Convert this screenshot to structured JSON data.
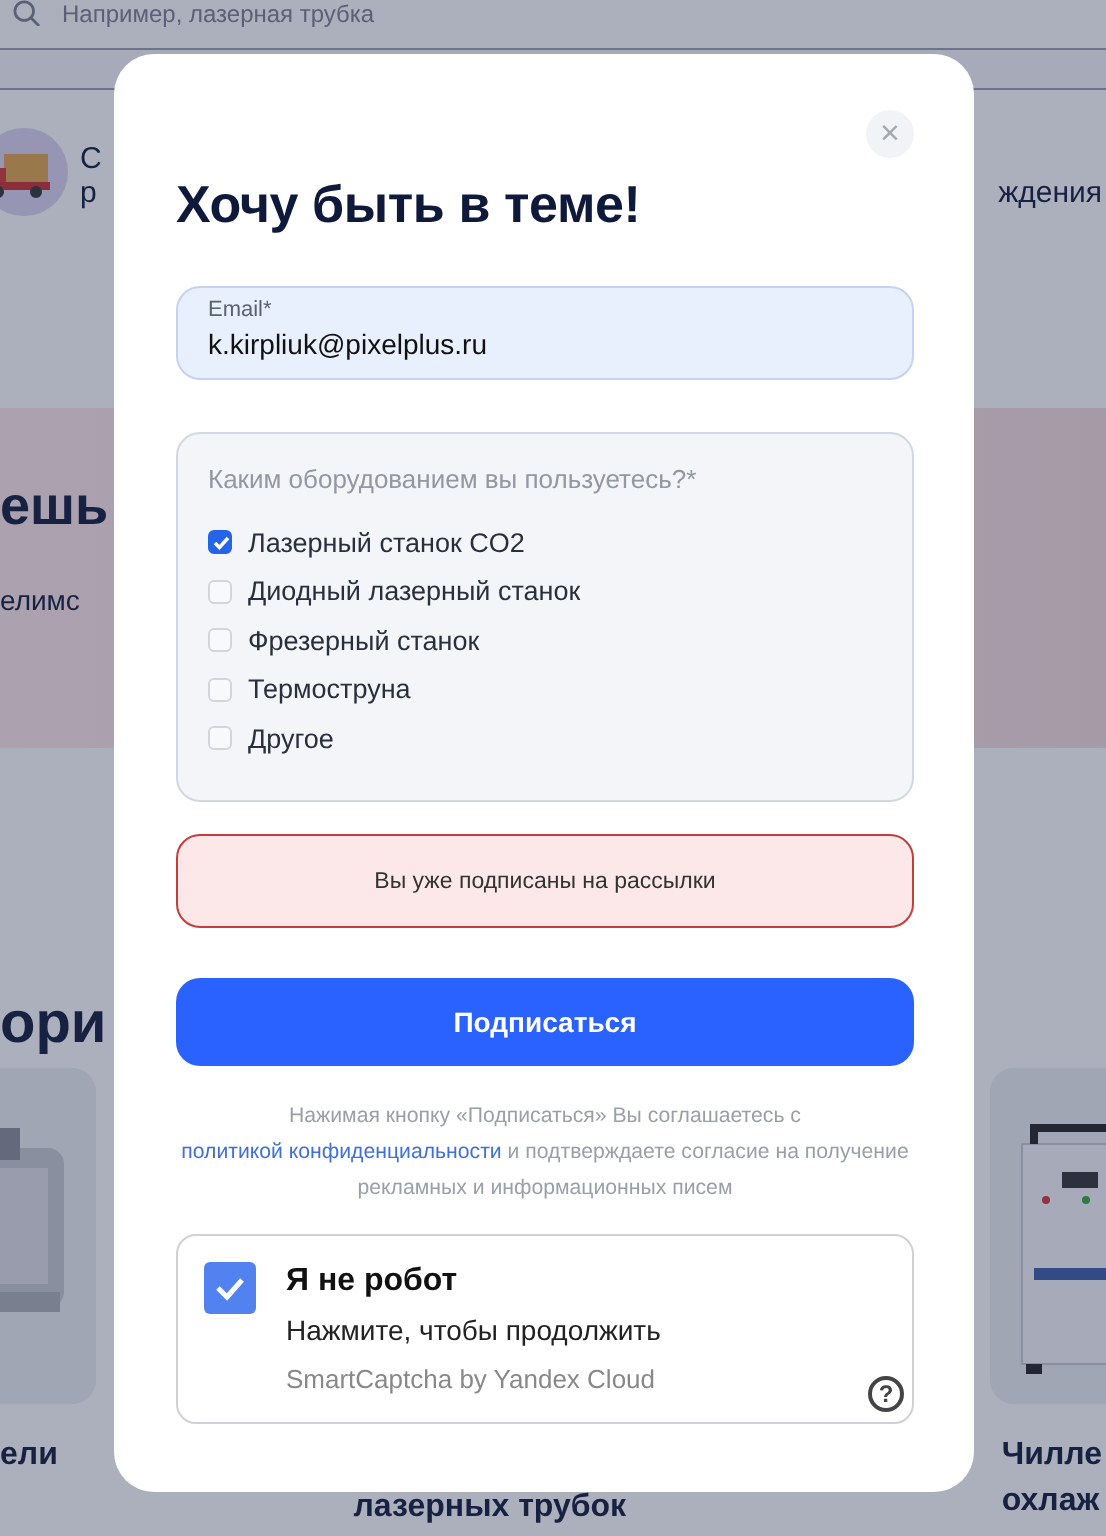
{
  "background": {
    "search": {
      "placeholder": "Например, лазерная трубка"
    },
    "delivery": {
      "lines": [
        "С",
        "р"
      ],
      "right_text": "ждения"
    },
    "banner": {
      "title": "ешь",
      "text": "елимс"
    },
    "section_title": "ори",
    "products": [
      {
        "lines": [
          "ели"
        ]
      },
      {
        "lines": [
          "лазерных трубок"
        ]
      },
      {
        "lines": [
          "Чилле",
          "охлаж"
        ]
      }
    ]
  },
  "modal": {
    "close": "×",
    "title": "Хочу быть в теме!",
    "email": {
      "label": "Email*",
      "value": "k.kirpliuk@pixelplus.ru"
    },
    "question": "Каким оборудованием вы пользуетесь?*",
    "options": [
      {
        "label": "Лазерный станок CO2",
        "checked": true
      },
      {
        "label": "Диодный лазерный станок",
        "checked": false
      },
      {
        "label": "Фрезерный станок",
        "checked": false
      },
      {
        "label": "Термоструна",
        "checked": false
      },
      {
        "label": "Другое",
        "checked": false
      }
    ],
    "error": "Вы уже подписаны на рассылки",
    "submit": "Подписаться",
    "consent": {
      "before": "Нажимая кнопку «Подписаться» Вы соглашаетесь с",
      "link": "политикой конфиденциальности",
      "after": "и подтверждаете согласие на получение рекламных и информационных писем"
    },
    "captcha": {
      "checked": true,
      "title": "Я не робот",
      "subtitle": "Нажмите, чтобы продолжить",
      "brand": "SmartCaptcha by Yandex Cloud",
      "help": "?"
    }
  }
}
